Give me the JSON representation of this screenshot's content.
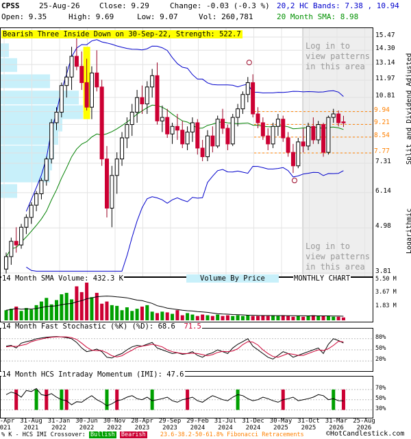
{
  "header": {
    "symbol": "CPSS",
    "date": "25-Aug-26",
    "close": "Close: 9.29",
    "change": "Change: -0.03 (-0.3 %)",
    "open": "Open: 9.35",
    "high": "High: 9.69",
    "low": "Low: 9.07",
    "volume": "Vol: 260,781",
    "bands": "20,2 HC Bands: 7.38 , 10.94",
    "sma": "20 Month SMA: 8.98"
  },
  "banner": "Bearish Three Inside Down on 30-Sep-22, Strength: 522.7",
  "login_text": "Log in to view patterns in this area",
  "side_labels": {
    "adjusted": "Split and Dividend Adjusted",
    "log": "Logarithmic"
  },
  "panel_titles": {
    "volume": "14 Month SMA Volume: 432.3 K",
    "vbp": "Volume By Price",
    "chart_type": "MONTHLY CHART",
    "stoch": "14 Month Fast Stochastic (%K) (%D): 68.6",
    "stoch_d": "71.5",
    "imi": "14 Month HCS Intraday Momentum (IMI): 47.6"
  },
  "footer": {
    "crossover": "% K - HCS IMI Crossover:",
    "bullish": "Bullish",
    "bearish": "Bearish",
    "fib": "23.6-38.2-50-61.8% Fibonacci Retracements",
    "copyright": "©HotCandlestick.com"
  },
  "colors": {
    "bull": "#00a000",
    "bear": "#cc0033",
    "band": "#0000cc",
    "sma": "#008000",
    "vbp": "#c8f0fa",
    "fib": "#ff8000",
    "highlight": "#ffff00"
  },
  "chart_data": {
    "type": "candlestick",
    "title": "CPSS",
    "y_scale": "log",
    "y_ticks": [
      "15.47",
      "14.30",
      "13.14",
      "11.97",
      "10.81",
      "9.94",
      "9.21",
      "8.54",
      "7.77",
      "7.31",
      "6.14",
      "4.98",
      "3.81"
    ],
    "fib_levels": [
      "9.94",
      "9.21",
      "8.54",
      "7.77"
    ],
    "x_labels": [
      "30-Apr 2021",
      "31-Aug 2021",
      "31-Jan 2022",
      "30-Jun 2022",
      "30-Nov 2022",
      "28-Apr 2023",
      "29-Sep 2023",
      "29-Feb 2024",
      "31-Jul 2024",
      "31-Dec 2024",
      "30-May 2025",
      "31-Oct 2025",
      "31-Mar 2026",
      "25-Aug 2026"
    ],
    "volume_ticks": [
      "5.50 M",
      "3.67 M",
      "1.83 M"
    ],
    "percent_ticks": [
      "80%",
      "50%",
      "20%"
    ],
    "imi_ticks": [
      "70%",
      "50%",
      "30%"
    ],
    "ohlc": [
      [
        3.9,
        4.3,
        3.8,
        4.2
      ],
      [
        4.2,
        4.7,
        4.0,
        4.6
      ],
      [
        4.6,
        5.0,
        4.3,
        4.5
      ],
      [
        4.5,
        5.1,
        4.4,
        5.0
      ],
      [
        5.0,
        5.4,
        4.8,
        5.3
      ],
      [
        5.3,
        5.8,
        5.1,
        5.7
      ],
      [
        5.7,
        6.2,
        5.5,
        6.1
      ],
      [
        6.1,
        6.7,
        5.9,
        6.6
      ],
      [
        6.6,
        7.6,
        6.4,
        7.5
      ],
      [
        7.5,
        9.5,
        7.3,
        9.3
      ],
      [
        9.3,
        10.2,
        8.9,
        9.9
      ],
      [
        9.9,
        11.8,
        9.6,
        11.6
      ],
      [
        11.6,
        13.0,
        10.8,
        12.2
      ],
      [
        12.2,
        14.6,
        11.3,
        13.8
      ],
      [
        13.8,
        15.4,
        12.7,
        13.0
      ],
      [
        13.0,
        14.2,
        11.3,
        11.8
      ],
      [
        11.8,
        13.6,
        10.0,
        10.2
      ],
      [
        10.2,
        13.0,
        9.5,
        12.5
      ],
      [
        12.5,
        14.3,
        11.2,
        11.5
      ],
      [
        11.5,
        12.0,
        7.2,
        7.5
      ],
      [
        7.5,
        8.1,
        5.3,
        5.6
      ],
      [
        5.6,
        7.2,
        5.0,
        6.8
      ],
      [
        6.8,
        7.8,
        6.1,
        7.5
      ],
      [
        7.5,
        8.8,
        7.2,
        8.5
      ],
      [
        8.5,
        9.6,
        8.0,
        9.2
      ],
      [
        9.2,
        10.4,
        8.6,
        9.9
      ],
      [
        9.9,
        11.3,
        9.3,
        10.8
      ],
      [
        10.8,
        11.6,
        9.8,
        10.4
      ],
      [
        10.4,
        11.9,
        9.8,
        11.5
      ],
      [
        11.5,
        12.8,
        10.8,
        12.3
      ],
      [
        12.3,
        13.3,
        9.2,
        9.4
      ],
      [
        9.4,
        10.3,
        8.8,
        9.6
      ],
      [
        9.6,
        10.1,
        8.5,
        8.7
      ],
      [
        8.7,
        9.3,
        8.2,
        9.1
      ],
      [
        9.1,
        9.8,
        8.4,
        8.9
      ],
      [
        8.9,
        9.4,
        8.0,
        8.2
      ],
      [
        8.2,
        9.1,
        7.9,
        8.8
      ],
      [
        8.8,
        9.6,
        8.3,
        9.3
      ],
      [
        9.3,
        9.5,
        7.7,
        8.0
      ],
      [
        8.0,
        8.4,
        7.4,
        7.6
      ],
      [
        7.6,
        8.9,
        7.4,
        8.6
      ],
      [
        8.6,
        9.1,
        7.8,
        8.1
      ],
      [
        8.1,
        9.7,
        8.0,
        9.5
      ],
      [
        9.5,
        10.1,
        8.7,
        9.0
      ],
      [
        9.0,
        9.2,
        7.9,
        8.2
      ],
      [
        8.2,
        9.8,
        8.1,
        9.6
      ],
      [
        9.6,
        10.4,
        9.1,
        10.1
      ],
      [
        10.1,
        11.2,
        9.8,
        11.0
      ],
      [
        11.0,
        12.2,
        10.5,
        11.8
      ],
      [
        11.8,
        12.4,
        9.6,
        9.8
      ],
      [
        9.8,
        10.2,
        9.0,
        9.3
      ],
      [
        9.3,
        9.6,
        8.4,
        8.6
      ],
      [
        8.6,
        9.0,
        7.9,
        8.2
      ],
      [
        8.2,
        9.3,
        8.0,
        9.1
      ],
      [
        9.1,
        9.8,
        8.6,
        9.5
      ],
      [
        9.5,
        9.7,
        8.3,
        8.5
      ],
      [
        8.5,
        8.8,
        7.6,
        7.8
      ],
      [
        7.8,
        8.2,
        6.9,
        7.2
      ],
      [
        7.2,
        8.5,
        7.1,
        8.3
      ],
      [
        8.3,
        9.0,
        7.8,
        8.1
      ],
      [
        8.1,
        9.3,
        7.9,
        9.1
      ],
      [
        9.1,
        9.6,
        8.2,
        8.4
      ],
      [
        8.4,
        9.4,
        8.2,
        9.2
      ],
      [
        9.2,
        9.3,
        7.6,
        7.8
      ],
      [
        7.8,
        9.7,
        7.7,
        9.6
      ],
      [
        9.6,
        10.1,
        9.3,
        9.8
      ],
      [
        9.8,
        10.0,
        9.1,
        9.3
      ],
      [
        9.35,
        9.69,
        9.07,
        9.29
      ]
    ],
    "volume": [
      1.4,
      1.6,
      1.9,
      1.3,
      1.7,
      1.5,
      2.1,
      2.6,
      3.1,
      2.2,
      2.8,
      3.6,
      3.8,
      2.9,
      4.7,
      3.9,
      5.5,
      3.2,
      3.8,
      2.3,
      2.6,
      2.1,
      2.0,
      1.4,
      1.8,
      1.3,
      1.6,
      1.9,
      2.1,
      1.2,
      1.0,
      1.2,
      1.1,
      0.9,
      1.4,
      0.7,
      1.0,
      0.8,
      0.6,
      0.8,
      0.7,
      0.6,
      0.8,
      0.6,
      0.7,
      0.6,
      0.7,
      0.6,
      0.7,
      0.6,
      0.6,
      0.7,
      0.6,
      0.7,
      0.6,
      0.7,
      0.6,
      0.5,
      0.6,
      0.5,
      0.6,
      0.7,
      0.6,
      0.6,
      0.6,
      0.5,
      0.5,
      0.4
    ],
    "stoch_k": [
      60,
      62,
      55,
      68,
      72,
      75,
      80,
      82,
      84,
      85,
      86,
      85,
      83,
      80,
      70,
      55,
      45,
      48,
      52,
      45,
      30,
      28,
      35,
      40,
      50,
      58,
      62,
      60,
      65,
      70,
      55,
      50,
      45,
      40,
      42,
      38,
      40,
      45,
      35,
      30,
      38,
      42,
      50,
      45,
      40,
      55,
      65,
      72,
      80,
      60,
      50,
      40,
      30,
      25,
      35,
      45,
      40,
      30,
      35,
      40,
      45,
      50,
      55,
      40,
      65,
      80,
      75,
      68.6
    ],
    "stoch_d": [
      58,
      60,
      59,
      62,
      65,
      72,
      76,
      79,
      82,
      84,
      85,
      85,
      85,
      83,
      78,
      68,
      57,
      49,
      48,
      48,
      42,
      34,
      31,
      34,
      42,
      49,
      57,
      60,
      62,
      65,
      62,
      58,
      50,
      45,
      42,
      40,
      40,
      41,
      40,
      37,
      34,
      37,
      43,
      46,
      45,
      47,
      53,
      64,
      72,
      71,
      63,
      50,
      40,
      32,
      30,
      35,
      40,
      38,
      35,
      35,
      40,
      45,
      50,
      48,
      53,
      62,
      73,
      71.5
    ],
    "imi": [
      60,
      65,
      62,
      55,
      68,
      66,
      72,
      60,
      58,
      62,
      55,
      50,
      48,
      40,
      46,
      45,
      52,
      58,
      50,
      45,
      38,
      42,
      48,
      50,
      55,
      58,
      52,
      50,
      55,
      48,
      50,
      52,
      55,
      48,
      45,
      50,
      52,
      55,
      48,
      45,
      52,
      58,
      54,
      50,
      48,
      55,
      60,
      58,
      52,
      48,
      50,
      55,
      52,
      48,
      45,
      50,
      52,
      55,
      48,
      50,
      52,
      55,
      60,
      58,
      50,
      52,
      48,
      47.6
    ],
    "imi_signals": [
      {
        "i": 2,
        "type": "bear"
      },
      {
        "i": 6,
        "type": "bull"
      },
      {
        "i": 8,
        "type": "bear"
      },
      {
        "i": 11,
        "type": "bull"
      },
      {
        "i": 12,
        "type": "bear"
      },
      {
        "i": 20,
        "type": "bull"
      },
      {
        "i": 22,
        "type": "bear"
      },
      {
        "i": 29,
        "type": "bull"
      },
      {
        "i": 36,
        "type": "bear"
      },
      {
        "i": 46,
        "type": "bull"
      },
      {
        "i": 55,
        "type": "bear"
      },
      {
        "i": 65,
        "type": "bull"
      },
      {
        "i": 67,
        "type": "bear"
      }
    ]
  }
}
